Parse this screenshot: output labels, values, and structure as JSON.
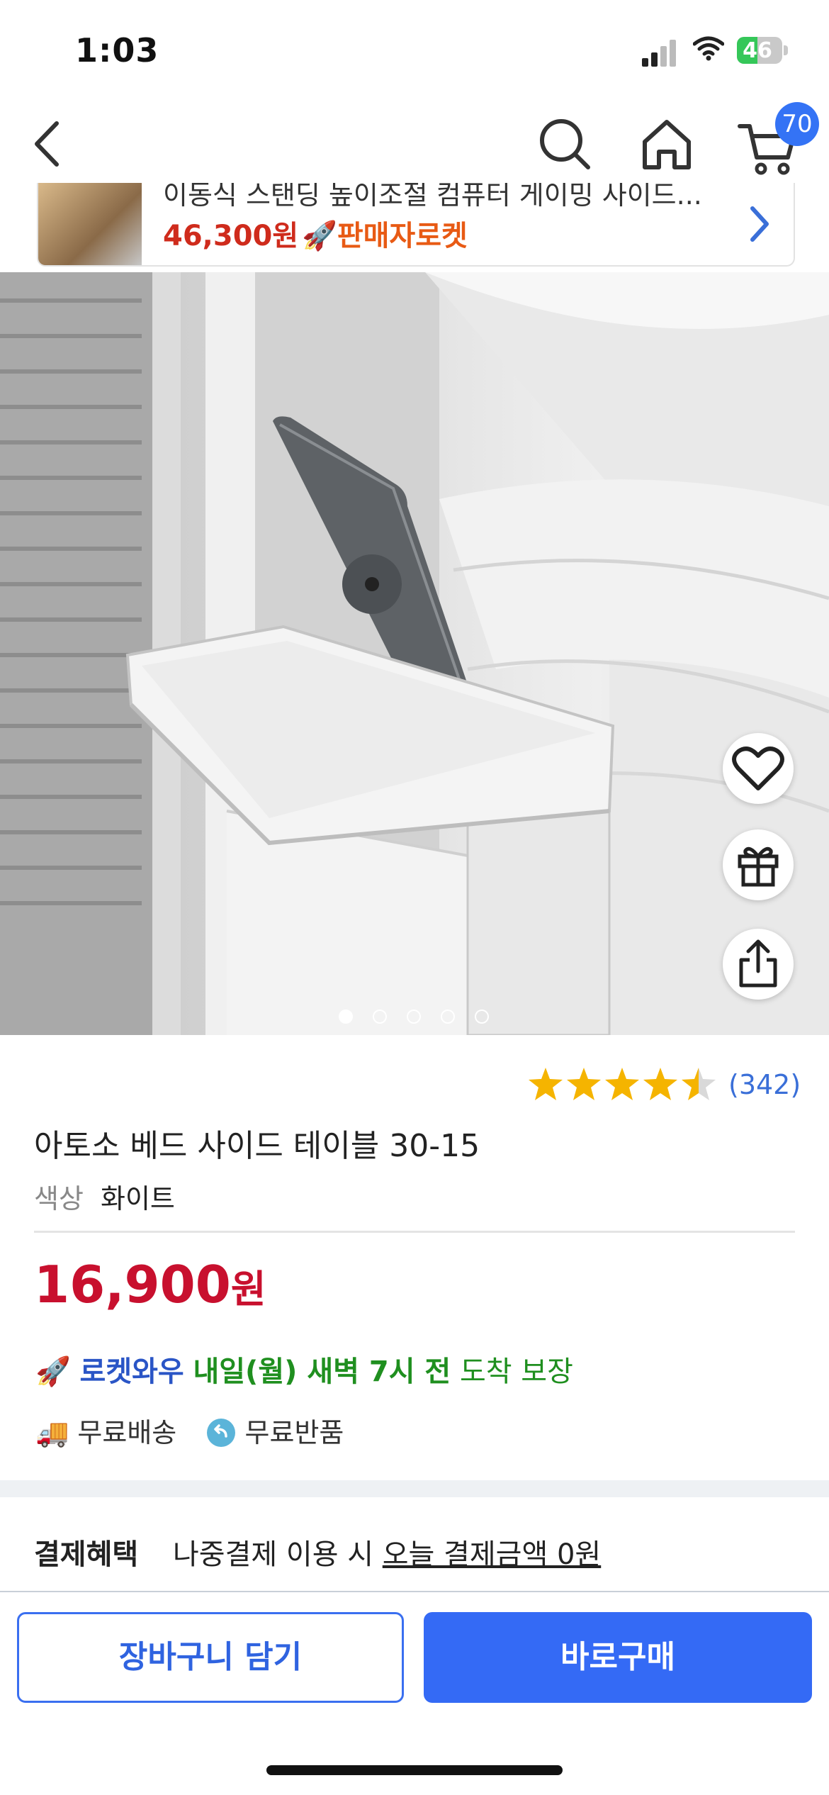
{
  "status_bar": {
    "time": "1:03",
    "battery": "46",
    "battery_level": 0.46
  },
  "nav": {
    "cart_count": "70",
    "icons": [
      "back-icon",
      "search-icon",
      "home-icon",
      "cart-icon"
    ]
  },
  "banner": {
    "title": "이동식 스탠딩 높이조절 컴퓨터 게이밍 사이드...",
    "price": "46,300원",
    "badge": "판매자로켓"
  },
  "gallery": {
    "image_count": 5,
    "active_index": 0
  },
  "product": {
    "rating": 4.5,
    "rating_count": "(342)",
    "title": "아토소 베드 사이드 테이블 30-15",
    "option_label": "색상",
    "option_value": "화이트",
    "price_number": "16,900",
    "price_unit": "원",
    "delivery": {
      "service": "로켓와우",
      "arrival": "내일(월) 새벽 7시 전",
      "guarantee": "도착 보장"
    },
    "free_shipping": "무료배송",
    "free_return": "무료반품"
  },
  "payment": {
    "label": "결제혜택",
    "text": "나중결제 이용 시",
    "link": "오늘 결제금액 0원"
  },
  "actions": {
    "add_to_cart": "장바구니 담기",
    "buy_now": "바로구매"
  },
  "colors": {
    "accent": "#346af5",
    "price": "#c8102e",
    "arrival": "#1f8f1f",
    "star": "#f5b400"
  }
}
